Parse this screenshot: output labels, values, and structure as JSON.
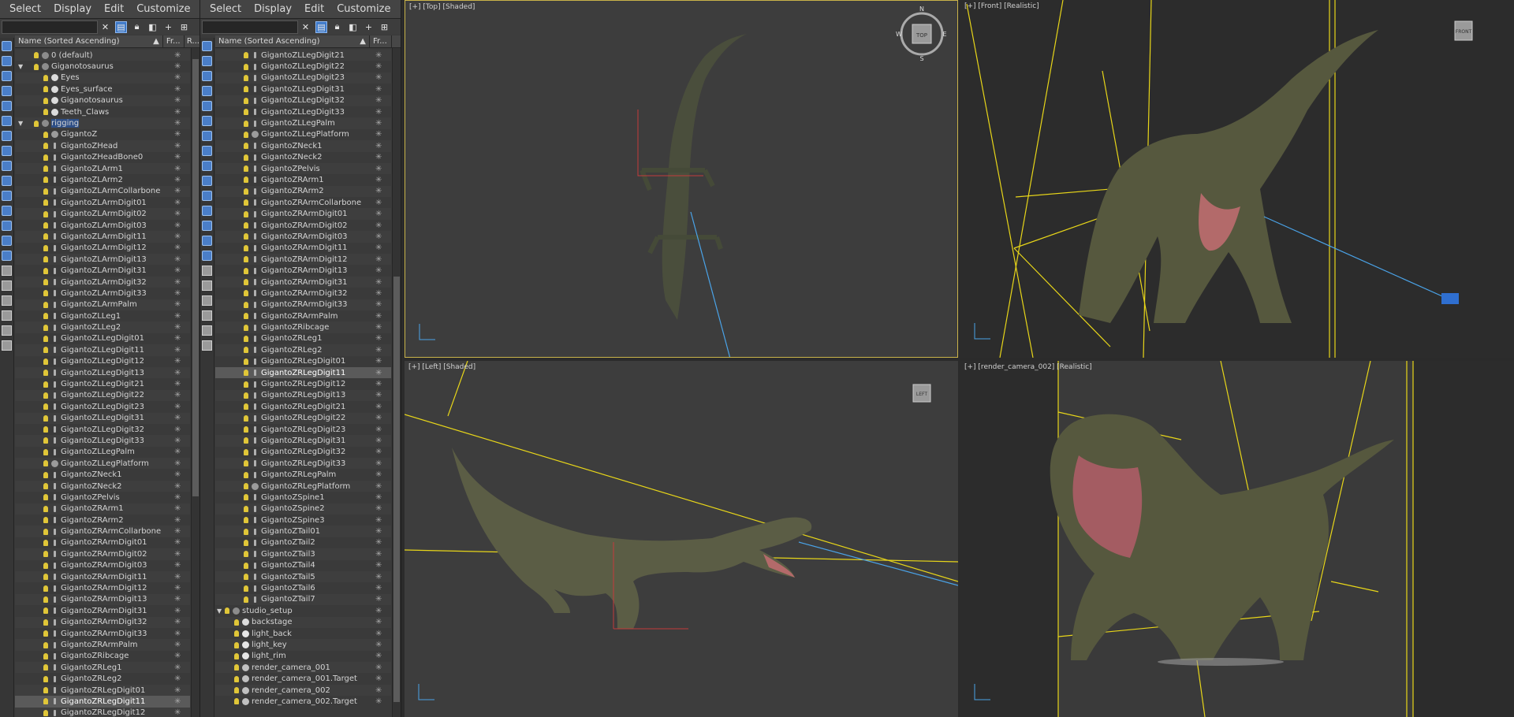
{
  "menu": [
    "Select",
    "Display",
    "Edit",
    "Customize"
  ],
  "columns": {
    "name": "Name (Sorted Ascending)",
    "frozen": "Fr...",
    "render": "R..."
  },
  "viewports": {
    "top": "[+] [Top] [Shaded]",
    "front": "[+] [Front] [Realistic]",
    "left": "[+] [Left] [Shaded]",
    "camera": "[+] [render_camera_002] [Realistic]"
  },
  "viewcube": {
    "top": "TOP",
    "front": "FRONT",
    "left": "LEFT",
    "compass": [
      "N",
      "E",
      "S",
      "W"
    ]
  },
  "explorer1": [
    {
      "n": "0 (default)",
      "l": 1,
      "t": "layer",
      "bulb": true
    },
    {
      "n": "Giganotosaurus",
      "l": 1,
      "t": "layer",
      "bulb": true,
      "exp": true
    },
    {
      "n": "Eyes",
      "l": 2,
      "t": "geo",
      "bulb": true
    },
    {
      "n": "Eyes_surface",
      "l": 2,
      "t": "geo",
      "bulb": true
    },
    {
      "n": "Giganotosaurus",
      "l": 2,
      "t": "geo",
      "bulb": true
    },
    {
      "n": "Teeth_Claws",
      "l": 2,
      "t": "geo",
      "bulb": true
    },
    {
      "n": "rigging",
      "l": 1,
      "t": "layer",
      "bulb": true,
      "exp": true,
      "hl": true
    },
    {
      "n": "GigantoZ",
      "l": 2,
      "t": "helper",
      "bulb": true
    },
    {
      "n": "GigantoZHead",
      "l": 2,
      "t": "bone",
      "bulb": true
    },
    {
      "n": "GigantoZHeadBone0",
      "l": 2,
      "t": "bone",
      "bulb": true
    },
    {
      "n": "GigantoZLArm1",
      "l": 2,
      "t": "bone",
      "bulb": true
    },
    {
      "n": "GigantoZLArm2",
      "l": 2,
      "t": "bone",
      "bulb": true
    },
    {
      "n": "GigantoZLArmCollarbone",
      "l": 2,
      "t": "bone",
      "bulb": true
    },
    {
      "n": "GigantoZLArmDigit01",
      "l": 2,
      "t": "bone",
      "bulb": true
    },
    {
      "n": "GigantoZLArmDigit02",
      "l": 2,
      "t": "bone",
      "bulb": true
    },
    {
      "n": "GigantoZLArmDigit03",
      "l": 2,
      "t": "bone",
      "bulb": true
    },
    {
      "n": "GigantoZLArmDigit11",
      "l": 2,
      "t": "bone",
      "bulb": true
    },
    {
      "n": "GigantoZLArmDigit12",
      "l": 2,
      "t": "bone",
      "bulb": true
    },
    {
      "n": "GigantoZLArmDigit13",
      "l": 2,
      "t": "bone",
      "bulb": true
    },
    {
      "n": "GigantoZLArmDigit31",
      "l": 2,
      "t": "bone",
      "bulb": true
    },
    {
      "n": "GigantoZLArmDigit32",
      "l": 2,
      "t": "bone",
      "bulb": true
    },
    {
      "n": "GigantoZLArmDigit33",
      "l": 2,
      "t": "bone",
      "bulb": true
    },
    {
      "n": "GigantoZLArmPalm",
      "l": 2,
      "t": "bone",
      "bulb": true
    },
    {
      "n": "GigantoZLLeg1",
      "l": 2,
      "t": "bone",
      "bulb": true
    },
    {
      "n": "GigantoZLLeg2",
      "l": 2,
      "t": "bone",
      "bulb": true
    },
    {
      "n": "GigantoZLLegDigit01",
      "l": 2,
      "t": "bone",
      "bulb": true
    },
    {
      "n": "GigantoZLLegDigit11",
      "l": 2,
      "t": "bone",
      "bulb": true
    },
    {
      "n": "GigantoZLLegDigit12",
      "l": 2,
      "t": "bone",
      "bulb": true
    },
    {
      "n": "GigantoZLLegDigit13",
      "l": 2,
      "t": "bone",
      "bulb": true
    },
    {
      "n": "GigantoZLLegDigit21",
      "l": 2,
      "t": "bone",
      "bulb": true
    },
    {
      "n": "GigantoZLLegDigit22",
      "l": 2,
      "t": "bone",
      "bulb": true
    },
    {
      "n": "GigantoZLLegDigit23",
      "l": 2,
      "t": "bone",
      "bulb": true
    },
    {
      "n": "GigantoZLLegDigit31",
      "l": 2,
      "t": "bone",
      "bulb": true
    },
    {
      "n": "GigantoZLLegDigit32",
      "l": 2,
      "t": "bone",
      "bulb": true
    },
    {
      "n": "GigantoZLLegDigit33",
      "l": 2,
      "t": "bone",
      "bulb": true
    },
    {
      "n": "GigantoZLLegPalm",
      "l": 2,
      "t": "bone",
      "bulb": true
    },
    {
      "n": "GigantoZLLegPlatform",
      "l": 2,
      "t": "helper",
      "bulb": true
    },
    {
      "n": "GigantoZNeck1",
      "l": 2,
      "t": "bone",
      "bulb": true
    },
    {
      "n": "GigantoZNeck2",
      "l": 2,
      "t": "bone",
      "bulb": true
    },
    {
      "n": "GigantoZPelvis",
      "l": 2,
      "t": "bone",
      "bulb": true
    },
    {
      "n": "GigantoZRArm1",
      "l": 2,
      "t": "bone",
      "bulb": true
    },
    {
      "n": "GigantoZRArm2",
      "l": 2,
      "t": "bone",
      "bulb": true
    },
    {
      "n": "GigantoZRArmCollarbone",
      "l": 2,
      "t": "bone",
      "bulb": true
    },
    {
      "n": "GigantoZRArmDigit01",
      "l": 2,
      "t": "bone",
      "bulb": true
    },
    {
      "n": "GigantoZRArmDigit02",
      "l": 2,
      "t": "bone",
      "bulb": true
    },
    {
      "n": "GigantoZRArmDigit03",
      "l": 2,
      "t": "bone",
      "bulb": true
    },
    {
      "n": "GigantoZRArmDigit11",
      "l": 2,
      "t": "bone",
      "bulb": true
    },
    {
      "n": "GigantoZRArmDigit12",
      "l": 2,
      "t": "bone",
      "bulb": true
    },
    {
      "n": "GigantoZRArmDigit13",
      "l": 2,
      "t": "bone",
      "bulb": true
    },
    {
      "n": "GigantoZRArmDigit31",
      "l": 2,
      "t": "bone",
      "bulb": true
    },
    {
      "n": "GigantoZRArmDigit32",
      "l": 2,
      "t": "bone",
      "bulb": true
    },
    {
      "n": "GigantoZRArmDigit33",
      "l": 2,
      "t": "bone",
      "bulb": true
    },
    {
      "n": "GigantoZRArmPalm",
      "l": 2,
      "t": "bone",
      "bulb": true
    },
    {
      "n": "GigantoZRibcage",
      "l": 2,
      "t": "bone",
      "bulb": true
    },
    {
      "n": "GigantoZRLeg1",
      "l": 2,
      "t": "bone",
      "bulb": true
    },
    {
      "n": "GigantoZRLeg2",
      "l": 2,
      "t": "bone",
      "bulb": true
    },
    {
      "n": "GigantoZRLegDigit01",
      "l": 2,
      "t": "bone",
      "bulb": true
    },
    {
      "n": "GigantoZRLegDigit11",
      "l": 2,
      "t": "bone",
      "bulb": true,
      "sel": true
    },
    {
      "n": "GigantoZRLegDigit12",
      "l": 2,
      "t": "bone",
      "bulb": true
    }
  ],
  "explorer2": [
    {
      "n": "GigantoZLLegDigit21",
      "l": 2,
      "t": "bone",
      "bulb": true
    },
    {
      "n": "GigantoZLLegDigit22",
      "l": 2,
      "t": "bone",
      "bulb": true
    },
    {
      "n": "GigantoZLLegDigit23",
      "l": 2,
      "t": "bone",
      "bulb": true
    },
    {
      "n": "GigantoZLLegDigit31",
      "l": 2,
      "t": "bone",
      "bulb": true
    },
    {
      "n": "GigantoZLLegDigit32",
      "l": 2,
      "t": "bone",
      "bulb": true
    },
    {
      "n": "GigantoZLLegDigit33",
      "l": 2,
      "t": "bone",
      "bulb": true
    },
    {
      "n": "GigantoZLLegPalm",
      "l": 2,
      "t": "bone",
      "bulb": true
    },
    {
      "n": "GigantoZLLegPlatform",
      "l": 2,
      "t": "helper",
      "bulb": true
    },
    {
      "n": "GigantoZNeck1",
      "l": 2,
      "t": "bone",
      "bulb": true
    },
    {
      "n": "GigantoZNeck2",
      "l": 2,
      "t": "bone",
      "bulb": true
    },
    {
      "n": "GigantoZPelvis",
      "l": 2,
      "t": "bone",
      "bulb": true
    },
    {
      "n": "GigantoZRArm1",
      "l": 2,
      "t": "bone",
      "bulb": true
    },
    {
      "n": "GigantoZRArm2",
      "l": 2,
      "t": "bone",
      "bulb": true
    },
    {
      "n": "GigantoZRArmCollarbone",
      "l": 2,
      "t": "bone",
      "bulb": true
    },
    {
      "n": "GigantoZRArmDigit01",
      "l": 2,
      "t": "bone",
      "bulb": true
    },
    {
      "n": "GigantoZRArmDigit02",
      "l": 2,
      "t": "bone",
      "bulb": true
    },
    {
      "n": "GigantoZRArmDigit03",
      "l": 2,
      "t": "bone",
      "bulb": true
    },
    {
      "n": "GigantoZRArmDigit11",
      "l": 2,
      "t": "bone",
      "bulb": true
    },
    {
      "n": "GigantoZRArmDigit12",
      "l": 2,
      "t": "bone",
      "bulb": true
    },
    {
      "n": "GigantoZRArmDigit13",
      "l": 2,
      "t": "bone",
      "bulb": true
    },
    {
      "n": "GigantoZRArmDigit31",
      "l": 2,
      "t": "bone",
      "bulb": true
    },
    {
      "n": "GigantoZRArmDigit32",
      "l": 2,
      "t": "bone",
      "bulb": true
    },
    {
      "n": "GigantoZRArmDigit33",
      "l": 2,
      "t": "bone",
      "bulb": true
    },
    {
      "n": "GigantoZRArmPalm",
      "l": 2,
      "t": "bone",
      "bulb": true
    },
    {
      "n": "GigantoZRibcage",
      "l": 2,
      "t": "bone",
      "bulb": true
    },
    {
      "n": "GigantoZRLeg1",
      "l": 2,
      "t": "bone",
      "bulb": true
    },
    {
      "n": "GigantoZRLeg2",
      "l": 2,
      "t": "bone",
      "bulb": true
    },
    {
      "n": "GigantoZRLegDigit01",
      "l": 2,
      "t": "bone",
      "bulb": true
    },
    {
      "n": "GigantoZRLegDigit11",
      "l": 2,
      "t": "bone",
      "bulb": true,
      "sel": true
    },
    {
      "n": "GigantoZRLegDigit12",
      "l": 2,
      "t": "bone",
      "bulb": true
    },
    {
      "n": "GigantoZRLegDigit13",
      "l": 2,
      "t": "bone",
      "bulb": true
    },
    {
      "n": "GigantoZRLegDigit21",
      "l": 2,
      "t": "bone",
      "bulb": true
    },
    {
      "n": "GigantoZRLegDigit22",
      "l": 2,
      "t": "bone",
      "bulb": true
    },
    {
      "n": "GigantoZRLegDigit23",
      "l": 2,
      "t": "bone",
      "bulb": true
    },
    {
      "n": "GigantoZRLegDigit31",
      "l": 2,
      "t": "bone",
      "bulb": true
    },
    {
      "n": "GigantoZRLegDigit32",
      "l": 2,
      "t": "bone",
      "bulb": true
    },
    {
      "n": "GigantoZRLegDigit33",
      "l": 2,
      "t": "bone",
      "bulb": true
    },
    {
      "n": "GigantoZRLegPalm",
      "l": 2,
      "t": "bone",
      "bulb": true
    },
    {
      "n": "GigantoZRLegPlatform",
      "l": 2,
      "t": "helper",
      "bulb": true
    },
    {
      "n": "GigantoZSpine1",
      "l": 2,
      "t": "bone",
      "bulb": true
    },
    {
      "n": "GigantoZSpine2",
      "l": 2,
      "t": "bone",
      "bulb": true
    },
    {
      "n": "GigantoZSpine3",
      "l": 2,
      "t": "bone",
      "bulb": true
    },
    {
      "n": "GigantoZTail01",
      "l": 2,
      "t": "bone",
      "bulb": true
    },
    {
      "n": "GigantoZTail2",
      "l": 2,
      "t": "bone",
      "bulb": true
    },
    {
      "n": "GigantoZTail3",
      "l": 2,
      "t": "bone",
      "bulb": true
    },
    {
      "n": "GigantoZTail4",
      "l": 2,
      "t": "bone",
      "bulb": true
    },
    {
      "n": "GigantoZTail5",
      "l": 2,
      "t": "bone",
      "bulb": true
    },
    {
      "n": "GigantoZTail6",
      "l": 2,
      "t": "bone",
      "bulb": true
    },
    {
      "n": "GigantoZTail7",
      "l": 2,
      "t": "bone",
      "bulb": true
    },
    {
      "n": "studio_setup",
      "l": 0,
      "t": "layer",
      "bulb": true,
      "exp": true
    },
    {
      "n": "backstage",
      "l": 1,
      "t": "geo",
      "bulb": true
    },
    {
      "n": "light_back",
      "l": 1,
      "t": "light",
      "bulb": true
    },
    {
      "n": "light_key",
      "l": 1,
      "t": "light",
      "bulb": true
    },
    {
      "n": "light_rim",
      "l": 1,
      "t": "light",
      "bulb": true
    },
    {
      "n": "render_camera_001",
      "l": 1,
      "t": "camera",
      "bulb": true
    },
    {
      "n": "render_camera_001.Target",
      "l": 1,
      "t": "camera",
      "bulb": true
    },
    {
      "n": "render_camera_002",
      "l": 1,
      "t": "camera",
      "bulb": true
    },
    {
      "n": "render_camera_002.Target",
      "l": 1,
      "t": "camera",
      "bulb": true
    }
  ],
  "colors": {
    "accent": "#3c78c8",
    "bulb": "#e0c638",
    "gizmo_yellow": "#e8d619",
    "selection_blue": "#4aa3e8",
    "viewport_border": "#c9b34a"
  },
  "icons": {
    "close": "close-icon",
    "filter": "filter-icon",
    "lock": "lock-icon",
    "add": "add-icon",
    "freeze": "snowflake-icon"
  }
}
